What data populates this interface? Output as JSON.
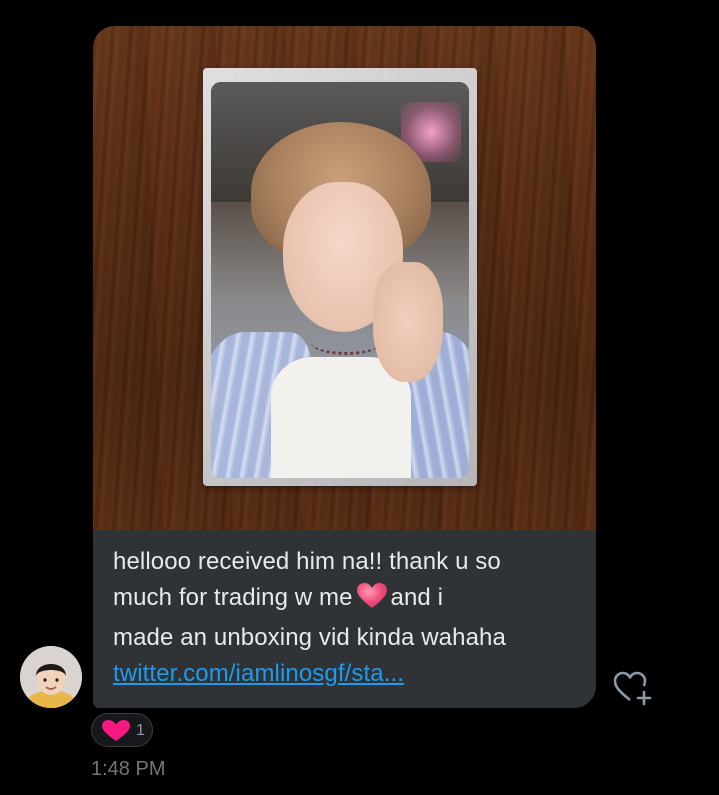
{
  "message": {
    "lines": [
      "hellooo received him na!! thank u so",
      "much for trading w me",
      "and i",
      "made an unboxing vid kinda wahaha"
    ],
    "emoji": "heart-emoji",
    "link_text": "twitter.com/iamlinosgf/sta..."
  },
  "reaction": {
    "icon": "heart-icon",
    "count": "1"
  },
  "timestamp": "1:48 PM",
  "colors": {
    "background": "#000000",
    "bubble": "#2f3336",
    "text": "#e7e9ea",
    "link": "#1d9bf0",
    "heart": "#f91880",
    "muted": "#71767b"
  }
}
